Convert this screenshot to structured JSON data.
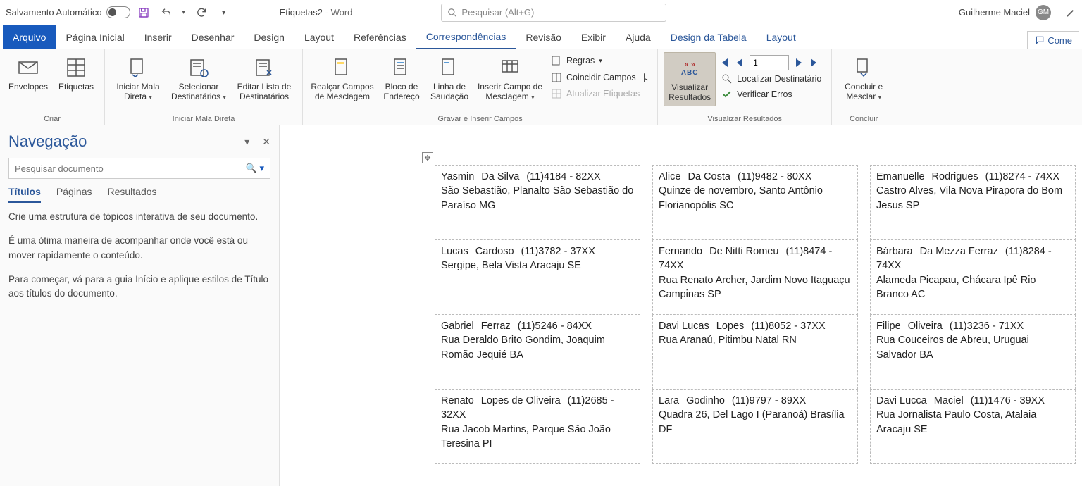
{
  "titlebar": {
    "autosave_label": "Salvamento Automático",
    "doc_name": "Etiquetas2",
    "app_separator": " - ",
    "app_name": "Word",
    "search_placeholder": "Pesquisar (Alt+G)",
    "user_name": "Guilherme Maciel",
    "user_initials": "GM"
  },
  "ribbon_tabs": {
    "file": "Arquivo",
    "tabs": [
      "Página Inicial",
      "Inserir",
      "Desenhar",
      "Design",
      "Layout",
      "Referências",
      "Correspondências",
      "Revisão",
      "Exibir",
      "Ajuda"
    ],
    "active_index": 6,
    "contextual": [
      "Design da Tabela",
      "Layout"
    ],
    "comments": "Come"
  },
  "ribbon": {
    "groups": {
      "criar": {
        "label": "Criar",
        "envelopes": "Envelopes",
        "etiquetas": "Etiquetas"
      },
      "mala": {
        "label": "Iniciar Mala Direta",
        "iniciar": "Iniciar Mala\nDireta",
        "selecionar": "Selecionar\nDestinatários",
        "editar": "Editar Lista de\nDestinatários"
      },
      "campos": {
        "label": "Gravar e Inserir Campos",
        "realcar": "Realçar Campos\nde Mesclagem",
        "bloco": "Bloco de\nEndereço",
        "linha": "Linha de\nSaudação",
        "inserir": "Inserir Campo de\nMesclagem",
        "regras": "Regras",
        "coincidir": "Coincidir Campos",
        "atualizar": "Atualizar Etiquetas"
      },
      "visualizar": {
        "label": "Visualizar Resultados",
        "preview": "Visualizar\nResultados",
        "record_value": "1",
        "localizar": "Localizar Destinatário",
        "verificar": "Verificar Erros"
      },
      "concluir": {
        "label": "Concluir",
        "concluir": "Concluir e\nMesclar"
      }
    }
  },
  "navpane": {
    "title": "Navegação",
    "search_placeholder": "Pesquisar documento",
    "tabs": {
      "titulos": "Títulos",
      "paginas": "Páginas",
      "resultados": "Resultados"
    },
    "p1": "Crie uma estrutura de tópicos interativa de seu documento.",
    "p2": "É uma ótima maneira de acompanhar onde você está ou mover rapidamente o conteúdo.",
    "p3": "Para começar, vá para a guia Início e aplique estilos de Título aos títulos do documento."
  },
  "labels": [
    [
      {
        "first": "Yasmin",
        "last": "Da Silva",
        "phone": "(11)4184 - 82XX",
        "addr": "São Sebastião, Planalto",
        "city": "São Sebastião do Paraíso",
        "state": "MG"
      },
      {
        "first": "Alice",
        "last": "Da Costa",
        "phone": "(11)9482 - 80XX",
        "addr": "Quinze de novembro, Santo Antônio",
        "city": "Florianopólis",
        "state": "SC"
      },
      {
        "first": "Emanuelle",
        "last": "Rodrigues",
        "phone": "(11)8274 - 74XX",
        "addr": "Castro Alves, Vila Nova",
        "city": "Pirapora do Bom Jesus",
        "state": "SP"
      }
    ],
    [
      {
        "first": "Lucas",
        "last": "Cardoso",
        "phone": "(11)3782 - 37XX",
        "addr": "Sergipe, Bela Vista",
        "city": "Aracaju",
        "state": "SE"
      },
      {
        "first": "Fernando",
        "last": "De Nitti Romeu",
        "phone": "(11)8474 - 74XX",
        "addr": "Rua Renato Archer, Jardim Novo Itaguaçu",
        "city": "Campinas",
        "state": "SP"
      },
      {
        "first": "Bárbara",
        "last": "Da Mezza Ferraz",
        "phone": "(11)8284 - 74XX",
        "addr": "Alameda Picapau, Chácara Ipê",
        "city": "Rio Branco",
        "state": "AC"
      }
    ],
    [
      {
        "first": "Gabriel",
        "last": "Ferraz",
        "phone": "(11)5246 - 84XX",
        "addr": "Rua Deraldo Brito Gondim, Joaquim Romão",
        "city": "Jequié",
        "state": "BA"
      },
      {
        "first": "Davi Lucas",
        "last": "Lopes",
        "phone": "(11)8052 - 37XX",
        "addr": "Rua Aranaú, Pitimbu",
        "city": "Natal",
        "state": "RN"
      },
      {
        "first": "Filipe",
        "last": "Oliveira",
        "phone": "(11)3236 - 71XX",
        "addr": "Rua Couceiros de Abreu, Uruguai",
        "city": "Salvador",
        "state": "BA"
      }
    ],
    [
      {
        "first": "Renato",
        "last": "Lopes de Oliveira",
        "phone": "(11)2685 - 32XX",
        "addr": "Rua Jacob Martins, Parque São João",
        "city": "Teresina",
        "state": "PI"
      },
      {
        "first": "Lara",
        "last": "Godinho",
        "phone": "(11)9797 - 89XX",
        "addr": "Quadra 26, Del Lago I (Paranoá)",
        "city": "Brasília",
        "state": "DF"
      },
      {
        "first": "Davi Lucca",
        "last": "Maciel",
        "phone": "(11)1476 - 39XX",
        "addr": "Rua Jornalista Paulo Costa, Atalaia",
        "city": "Aracaju",
        "state": "SE"
      }
    ]
  ]
}
